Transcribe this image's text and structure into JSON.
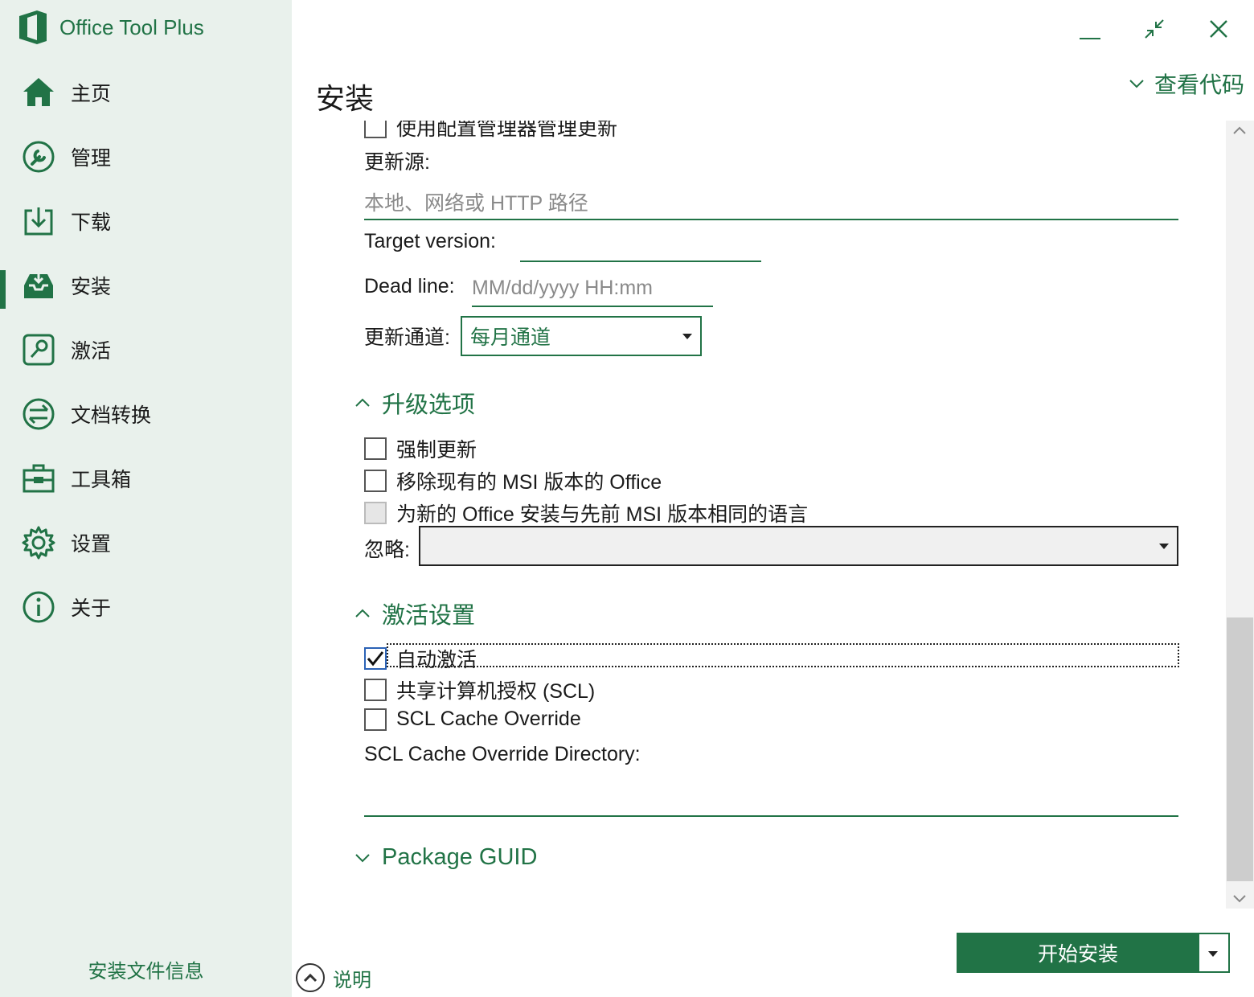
{
  "app": {
    "title": "Office Tool Plus"
  },
  "sidebar": {
    "items": [
      {
        "label": "主页",
        "icon": "home-icon"
      },
      {
        "label": "管理",
        "icon": "wrench-icon"
      },
      {
        "label": "下载",
        "icon": "download-icon"
      },
      {
        "label": "安装",
        "icon": "install-tray-icon",
        "active": true
      },
      {
        "label": "激活",
        "icon": "key-icon"
      },
      {
        "label": "文档转换",
        "icon": "convert-icon"
      },
      {
        "label": "工具箱",
        "icon": "toolbox-icon"
      },
      {
        "label": "设置",
        "icon": "gear-icon"
      },
      {
        "label": "关于",
        "icon": "info-icon"
      }
    ],
    "footer": "安装文件信息"
  },
  "header": {
    "title": "安装",
    "view_code": "查看代码"
  },
  "update": {
    "config_manager_label": "使用配置管理器管理更新",
    "source_label": "更新源:",
    "source_placeholder": "本地、网络或 HTTP 路径",
    "target_version_label": "Target version:",
    "target_version_value": "",
    "deadline_label": "Dead line:",
    "deadline_placeholder": "MM/dd/yyyy HH:mm",
    "channel_label": "更新通道:",
    "channel_value": "每月通道"
  },
  "upgrade": {
    "title": "升级选项",
    "force_update": "强制更新",
    "remove_msi": "移除现有的 MSI 版本的 Office",
    "same_language": "为新的 Office 安装与先前 MSI 版本相同的语言",
    "ignore_label": "忽略:",
    "ignore_value": ""
  },
  "activation": {
    "title": "激活设置",
    "auto_activate": "自动激活",
    "scl": "共享计算机授权 (SCL)",
    "scl_cache_override": "SCL Cache Override",
    "scl_cache_dir_label": "SCL Cache Override Directory:",
    "scl_cache_dir_value": ""
  },
  "package": {
    "title": "Package GUID"
  },
  "bottom": {
    "help": "说明",
    "install": "开始安装"
  },
  "colors": {
    "accent": "#217346",
    "sidebar_bg": "#e9f1ec"
  }
}
